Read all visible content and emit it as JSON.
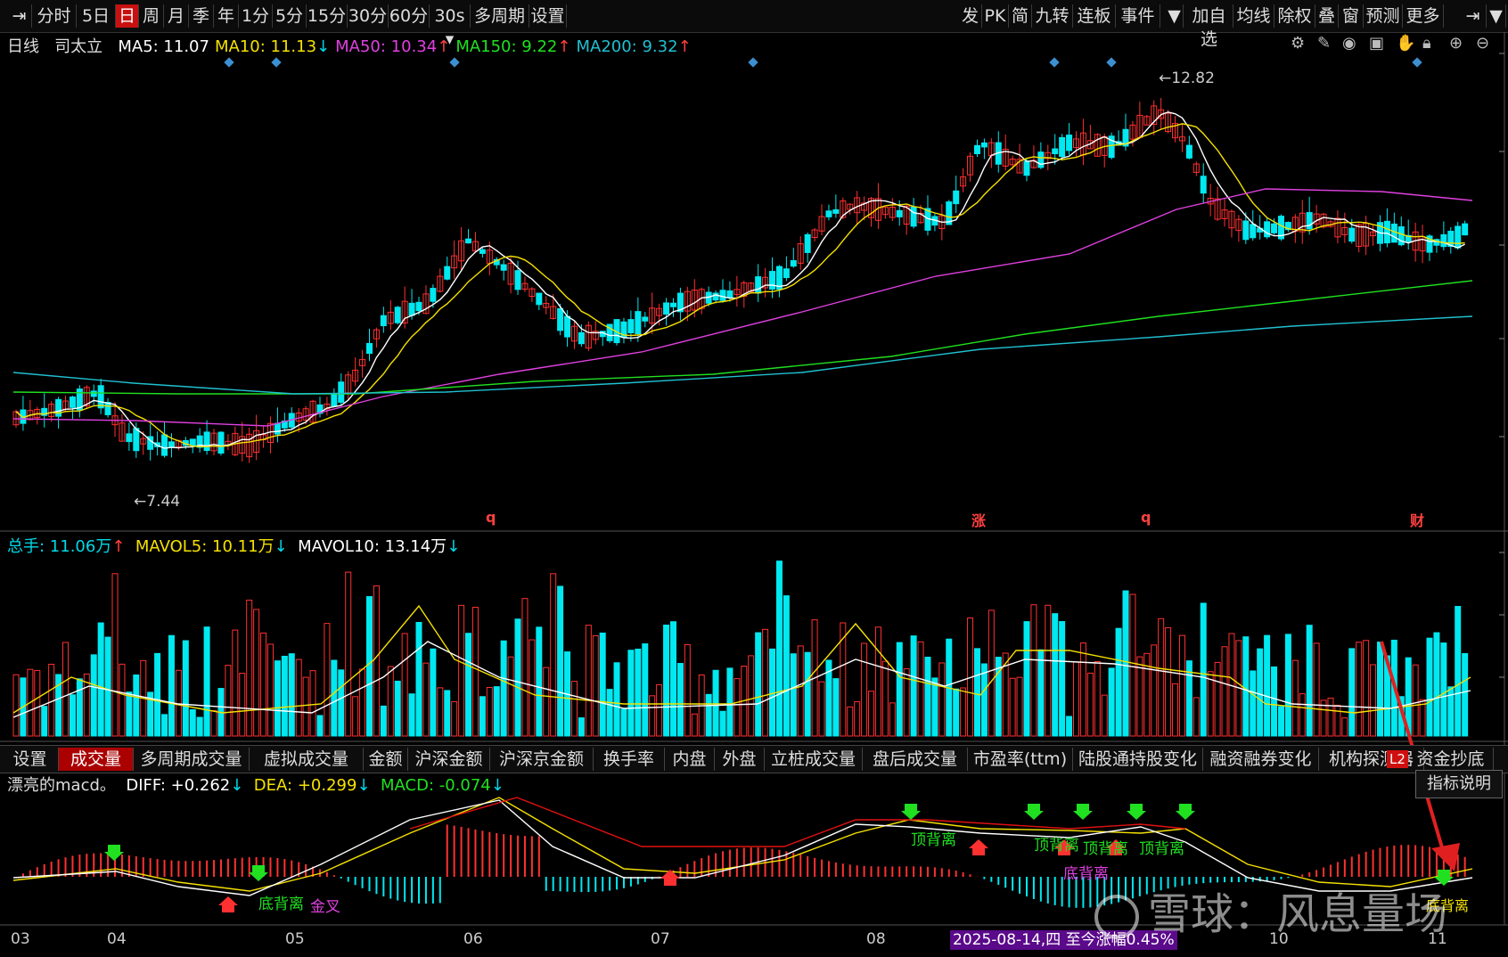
{
  "toolbar": {
    "left": [
      "分时",
      "5日",
      "日",
      "周",
      "月",
      "季",
      "年",
      "1分",
      "5分",
      "15分",
      "30分",
      "60分",
      "30s",
      "多周期",
      "设置"
    ],
    "active": "日",
    "right": [
      "发",
      "PK",
      "简",
      "九转",
      "连板",
      "事件",
      "加自选",
      "均线",
      "除权",
      "叠",
      "窗",
      "预测",
      "更多"
    ]
  },
  "main_chart": {
    "period": "日线",
    "stock_name": "司太立",
    "ma": [
      {
        "name": "MA5",
        "value": "11.07",
        "color": "#ffffff",
        "arrow": ""
      },
      {
        "name": "MA10",
        "value": "11.13",
        "color": "#f5e100",
        "arrow": "↓"
      },
      {
        "name": "MA50",
        "value": "10.34",
        "color": "#e040e0",
        "arrow": "↑"
      },
      {
        "name": "MA150",
        "value": "9.22",
        "color": "#20e020",
        "arrow": "↑"
      },
      {
        "name": "MA200",
        "value": "9.32",
        "color": "#20c0d0",
        "arrow": "↑"
      }
    ],
    "high_label": "12.82",
    "low_label": "7.44",
    "event_marks": [
      "q",
      "涨",
      "q",
      "财"
    ]
  },
  "volume_chart": {
    "label": "总手",
    "value": "11.06万",
    "mavol5": "10.11万",
    "mavol10": "13.14万"
  },
  "indicator_tabs": [
    "设置",
    "成交量",
    "多周期成交量",
    "虚拟成交量",
    "金额",
    "沪深金额",
    "沪深京金额",
    "换手率",
    "内盘",
    "外盘",
    "立桩成交量",
    "盘后成交量",
    "市盈率(ttm)",
    "陆股通持股变化",
    "融资融券变化",
    "机构探测器",
    "资金抄底"
  ],
  "active_tab": "成交量",
  "macd": {
    "name": "漂亮的macd。",
    "diff": "+0.262",
    "dea": "+0.299",
    "macd": "-0.074",
    "explain_button": "指标说明",
    "labels": [
      "顶背离",
      "顶背离",
      "顶背离",
      "顶背离",
      "底背离",
      "底背离",
      "金叉",
      "底背离"
    ]
  },
  "x_axis": {
    "months": [
      "03",
      "04",
      "05",
      "06",
      "07",
      "08",
      "10",
      "11"
    ],
    "tooltip": "2025-08-14,四 至今涨幅0.45%"
  },
  "watermark": "雪球：风息量场",
  "colors": {
    "up": "#ff3030",
    "down": "#00e8f0",
    "ma5": "#ffffff",
    "ma10": "#f5e100",
    "ma50": "#e040e0",
    "ma150": "#20e020",
    "ma200": "#20c0d0"
  }
}
